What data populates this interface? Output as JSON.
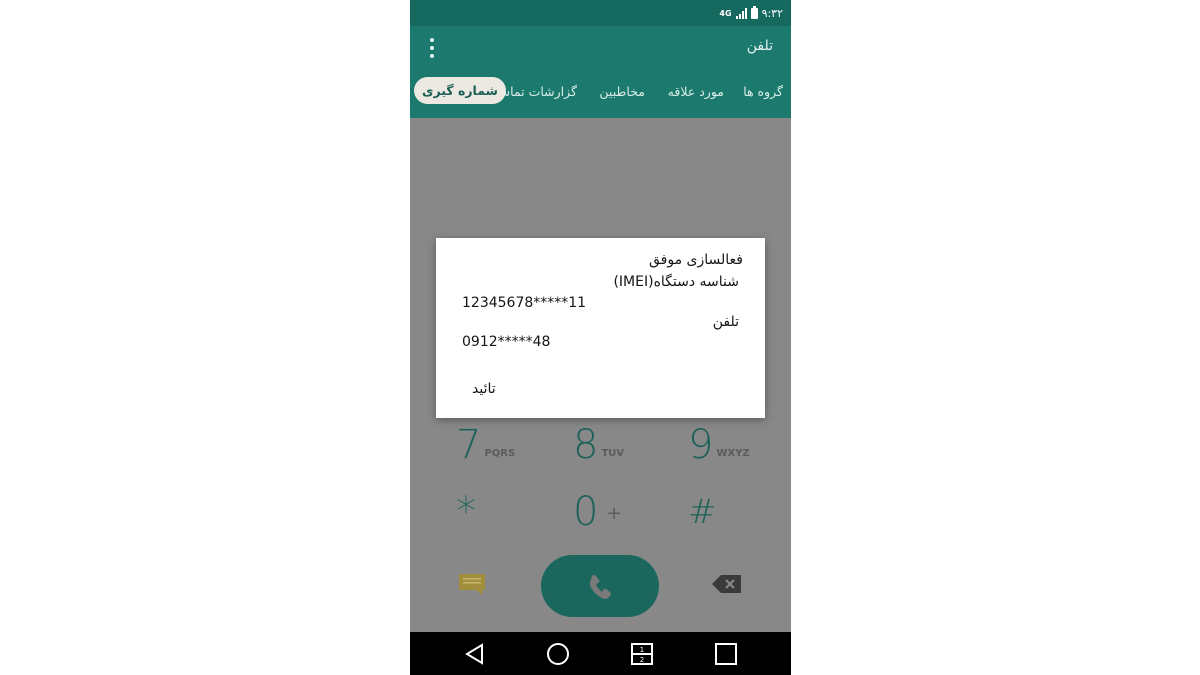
{
  "status_bar": {
    "time": "۹:۳۲",
    "signal_label": "4G",
    "icons": [
      "signal-icon",
      "battery-icon"
    ]
  },
  "app_bar": {
    "title": "تلفن",
    "menu_icon": "overflow-menu-icon"
  },
  "tabs": [
    {
      "label": "گروه ها",
      "active": false
    },
    {
      "label": "مورد علاقه",
      "active": false
    },
    {
      "label": "مخاطبین",
      "active": false
    },
    {
      "label": "گزارشات تماس",
      "active": false
    },
    {
      "label": "شماره گیری",
      "active": true
    }
  ],
  "dialpad": {
    "keys": [
      {
        "digit": "7",
        "letters": "PQRS"
      },
      {
        "digit": "8",
        "letters": "TUV"
      },
      {
        "digit": "9",
        "letters": "WXYZ"
      },
      {
        "digit": "*",
        "letters": ""
      },
      {
        "digit": "0",
        "letters": "+"
      },
      {
        "digit": "#",
        "letters": ""
      }
    ],
    "call_icon": "phone-icon",
    "message_icon": "message-icon",
    "backspace_icon": "backspace-icon"
  },
  "dialog": {
    "title": "فعالسازی موفق",
    "imei_label": "شناسه دستگاه(IMEI)",
    "imei_value": "12345678*****11",
    "phone_label": "تلفن",
    "phone_value": "0912*****48",
    "confirm_label": "تائید"
  },
  "nav_bar": {
    "buttons": [
      "back-icon",
      "home-icon",
      "dual-window-icon",
      "recents-icon"
    ]
  },
  "colors": {
    "primary": "#1b7a6d",
    "status_bar": "#16695e",
    "dim_overlay": "#888888",
    "accent_dark": "#1b675d"
  }
}
